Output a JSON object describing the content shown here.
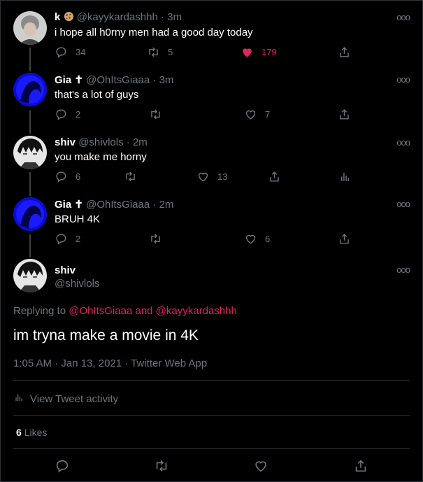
{
  "tweets": [
    {
      "name": "k",
      "handle": "@kayykardashhh",
      "time": "3m",
      "text": "i hope all h0rny men had a good day today",
      "replies": "34",
      "retweets": "5",
      "likes": "179",
      "liked": true
    },
    {
      "name": "Gia",
      "handle": "@OhItsGiaaa",
      "time": "3m",
      "text": "that's a lot of guys",
      "replies": "2",
      "retweets": "",
      "likes": "7"
    },
    {
      "name": "shiv",
      "handle": "@shivlols",
      "time": "2m",
      "text": "you make me horny",
      "replies": "6",
      "retweets": "",
      "likes": "13"
    },
    {
      "name": "Gia",
      "handle": "@OhItsGiaaa",
      "time": "2m",
      "text": "BRUH 4K",
      "replies": "2",
      "retweets": "",
      "likes": "6"
    }
  ],
  "main": {
    "name": "shiv",
    "handle": "@shivlols",
    "replying_to_prefix": "Replying to",
    "replying_to_user1": "@OhItsGiaaa",
    "replying_to_and": "and",
    "replying_to_user2": "@kayykardashhh",
    "text": "im tryna make a movie in 4K",
    "timestamp": "1:05 AM · Jan 13, 2021 · Twitter Web App",
    "view_activity": "View Tweet activity",
    "likes_count": "6",
    "likes_label": "Likes"
  },
  "separator_dot": "·",
  "more_glyph": "ooo",
  "name_badge": "✝",
  "colors": {
    "background": "#000000",
    "secondary_text": "#6e767d",
    "like_red": "#e0245e",
    "divider": "#2f3336"
  },
  "icons": [
    "reply-icon",
    "retweet-icon",
    "like-icon",
    "share-icon",
    "analytics-icon",
    "more-icon"
  ]
}
